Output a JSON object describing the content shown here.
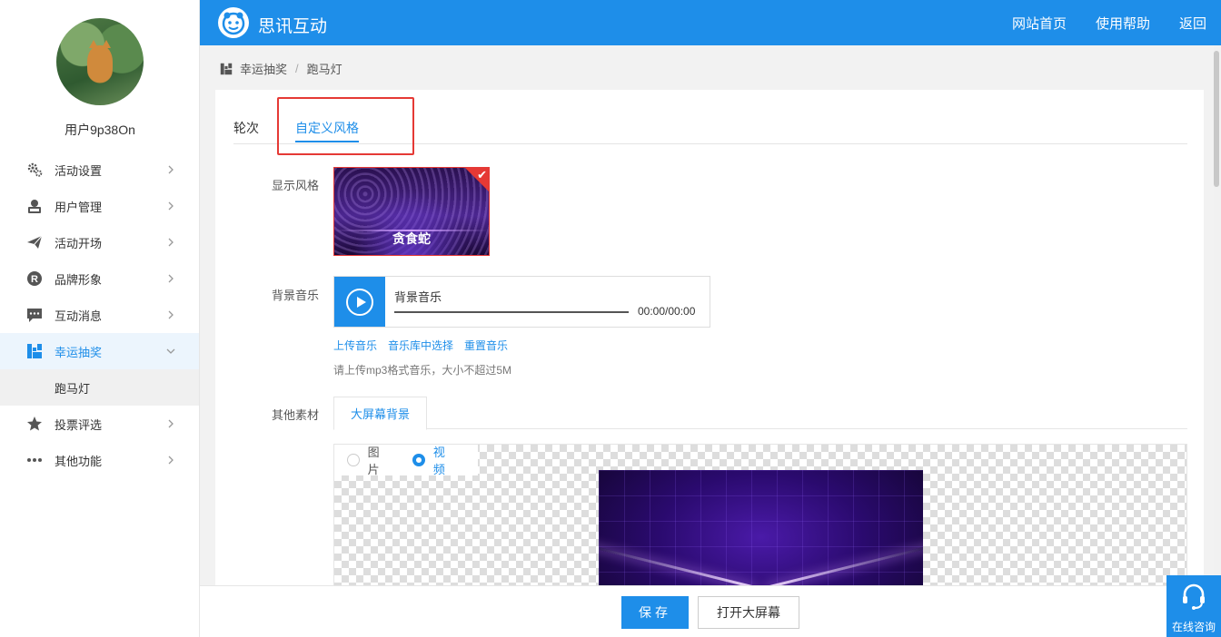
{
  "user": {
    "name": "用户9p38On"
  },
  "sidebar": {
    "items": [
      {
        "label": "活动设置",
        "icon": "gears-icon"
      },
      {
        "label": "用户管理",
        "icon": "user-card-icon"
      },
      {
        "label": "活动开场",
        "icon": "paper-plane-icon"
      },
      {
        "label": "品牌形象",
        "icon": "registered-icon"
      },
      {
        "label": "互动消息",
        "icon": "chat-icon"
      },
      {
        "label": "幸运抽奖",
        "icon": "lottery-icon"
      },
      {
        "label": "投票评选",
        "icon": "star-icon"
      },
      {
        "label": "其他功能",
        "icon": "more-dots-icon"
      }
    ],
    "submenu": {
      "label": "跑马灯"
    }
  },
  "header": {
    "brand": "思讯互动",
    "nav": [
      "网站首页",
      "使用帮助",
      "返回"
    ],
    "accent": "#1e8ee9"
  },
  "breadcrumb": {
    "parent": "幸运抽奖",
    "separator": "/",
    "current": "跑马灯"
  },
  "tabs": [
    "轮次",
    "自定义风格"
  ],
  "style_section": {
    "label": "显示风格",
    "selected_name": "贪食蛇"
  },
  "music": {
    "label": "背景音乐",
    "title": "背景音乐",
    "time": "00:00/00:00",
    "links": [
      "上传音乐",
      "音乐库中选择",
      "重置音乐"
    ],
    "hint": "请上传mp3格式音乐，大小不超过5M"
  },
  "materials": {
    "label": "其他素材",
    "tab": "大屏幕背景",
    "options": [
      "图片",
      "视频"
    ],
    "selected": "视频"
  },
  "footer": {
    "save": "保存",
    "open": "打开大屏幕"
  },
  "consult": {
    "label": "在线咨询"
  }
}
